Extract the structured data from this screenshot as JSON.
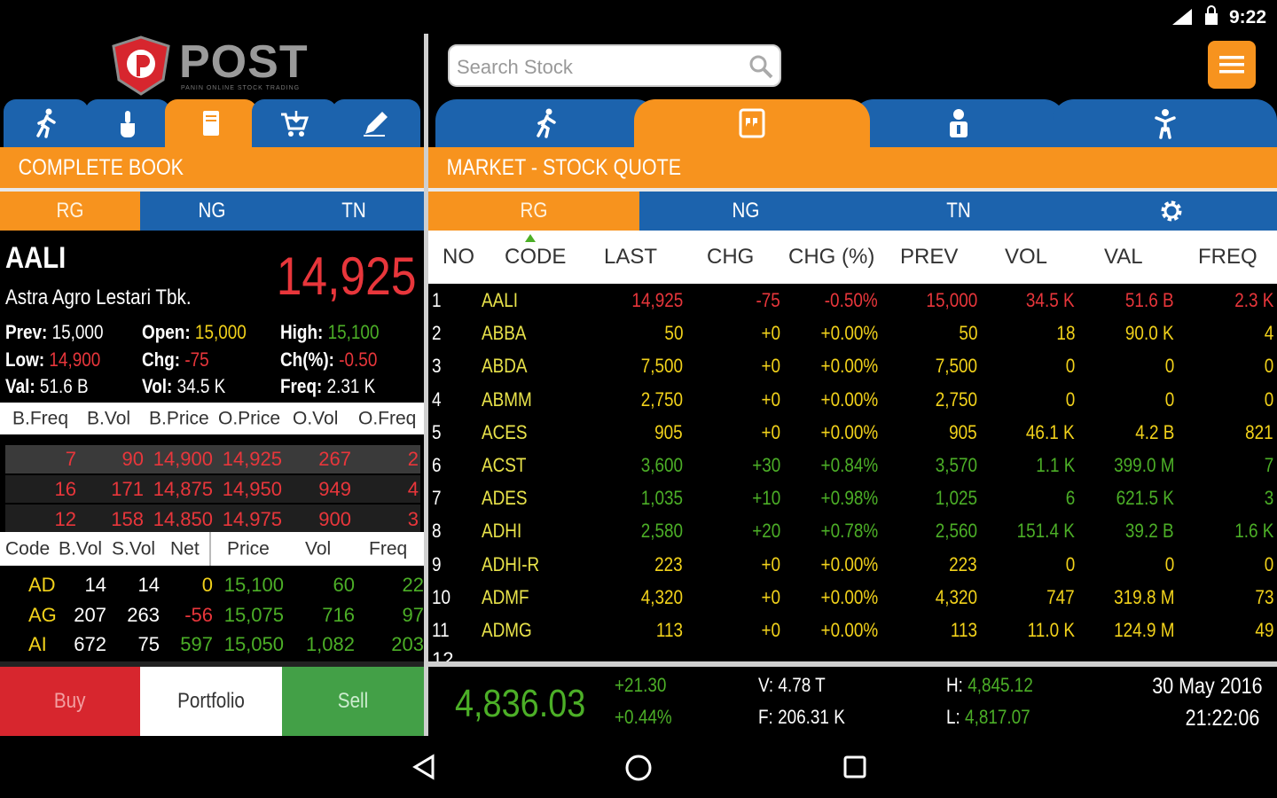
{
  "status": {
    "time": "9:22"
  },
  "brand": {
    "name": "POST",
    "tagline": "PANIN ONLINE STOCK TRADING"
  },
  "search": {
    "placeholder": "Search Stock"
  },
  "left": {
    "section_title": "COMPLETE BOOK",
    "market_tabs": [
      "RG",
      "NG",
      "TN"
    ],
    "stock": {
      "code": "AALI",
      "name": "Astra Agro Lestari Tbk.",
      "price": "14,925",
      "prev_label": "Prev:",
      "prev": "15,000",
      "open_label": "Open:",
      "open": "15,000",
      "high_label": "High:",
      "high": "15,100",
      "low_label": "Low:",
      "low": "14,900",
      "chg_label": "Chg:",
      "chg": "-75",
      "chgp_label": "Ch(%):",
      "chgp": "-0.50",
      "val_label": "Val:",
      "val": "51.6 B",
      "vol_label": "Vol:",
      "vol": "34.5 K",
      "freq_label": "Freq:",
      "freq": "2.31 K"
    },
    "orderbook": {
      "headers": [
        "B.Freq",
        "B.Vol",
        "B.Price",
        "O.Price",
        "O.Vol",
        "O.Freq"
      ],
      "rows": [
        [
          "7",
          "90",
          "14,900",
          "14,925",
          "267",
          "2"
        ],
        [
          "16",
          "171",
          "14,875",
          "14,950",
          "949",
          "4"
        ],
        [
          "12",
          "158",
          "14,850",
          "14,975",
          "900",
          "3"
        ]
      ]
    },
    "broker": {
      "headers": [
        "Code",
        "B.Vol",
        "S.Vol",
        "Net",
        "Price",
        "Vol",
        "Freq"
      ],
      "rows": [
        [
          "AD",
          "14",
          "14",
          "0",
          "15,100",
          "60",
          "22"
        ],
        [
          "AG",
          "207",
          "263",
          "-56",
          "15,075",
          "716",
          "97"
        ],
        [
          "AI",
          "672",
          "75",
          "597",
          "15,050",
          "1,082",
          "203"
        ]
      ]
    },
    "buttons": {
      "buy": "Buy",
      "portfolio": "Portfolio",
      "sell": "Sell"
    }
  },
  "right": {
    "section_title": "MARKET - STOCK QUOTE",
    "market_tabs": [
      "RG",
      "NG",
      "TN"
    ],
    "table": {
      "headers": [
        "NO",
        "CODE",
        "LAST",
        "CHG",
        "CHG (%)",
        "PREV",
        "VOL",
        "VAL",
        "FREQ"
      ],
      "rows": [
        [
          "1",
          "AALI",
          "14,925",
          "-75",
          "-0.50%",
          "15,000",
          "34.5 K",
          "51.6 B",
          "2.3 K"
        ],
        [
          "2",
          "ABBA",
          "50",
          "+0",
          "+0.00%",
          "50",
          "18",
          "90.0 K",
          "4"
        ],
        [
          "3",
          "ABDA",
          "7,500",
          "+0",
          "+0.00%",
          "7,500",
          "0",
          "0",
          "0"
        ],
        [
          "4",
          "ABMM",
          "2,750",
          "+0",
          "+0.00%",
          "2,750",
          "0",
          "0",
          "0"
        ],
        [
          "5",
          "ACES",
          "905",
          "+0",
          "+0.00%",
          "905",
          "46.1 K",
          "4.2 B",
          "821"
        ],
        [
          "6",
          "ACST",
          "3,600",
          "+30",
          "+0.84%",
          "3,570",
          "1.1 K",
          "399.0 M",
          "7"
        ],
        [
          "7",
          "ADES",
          "1,035",
          "+10",
          "+0.98%",
          "1,025",
          "6",
          "621.5 K",
          "3"
        ],
        [
          "8",
          "ADHI",
          "2,580",
          "+20",
          "+0.78%",
          "2,560",
          "151.4 K",
          "39.2 B",
          "1.6 K"
        ],
        [
          "9",
          "ADHI-R",
          "223",
          "+0",
          "+0.00%",
          "223",
          "0",
          "0",
          "0"
        ],
        [
          "10",
          "ADMF",
          "4,320",
          "+0",
          "+0.00%",
          "4,320",
          "747",
          "319.8 M",
          "73"
        ],
        [
          "11",
          "ADMG",
          "113",
          "+0",
          "+0.00%",
          "113",
          "11.0 K",
          "124.9 M",
          "49"
        ]
      ]
    },
    "index": {
      "value": "4,836.03",
      "change": "+21.30",
      "change_pct": "+0.44%",
      "volume": "V: 4.78 T",
      "frequency": "F: 206.31 K",
      "high_label": "H:",
      "high": "4,845.12",
      "low_label": "L:",
      "low": "4,817.07",
      "date": "30 May 2016",
      "time": "21:22:06"
    }
  },
  "colors": {
    "orange": "#f7931e",
    "blue": "#1c63ad",
    "up": "#4caf27",
    "down": "#e8363b",
    "flat": "#f2d21b",
    "code": "#e8e24a"
  },
  "icons": [
    "running-man-icon",
    "hand-pointer-icon",
    "book-icon",
    "basket-icon",
    "pencil-icon",
    "quote-icon",
    "person-icon",
    "kid-icon",
    "gear-icon",
    "search-icon",
    "menu-icon"
  ]
}
